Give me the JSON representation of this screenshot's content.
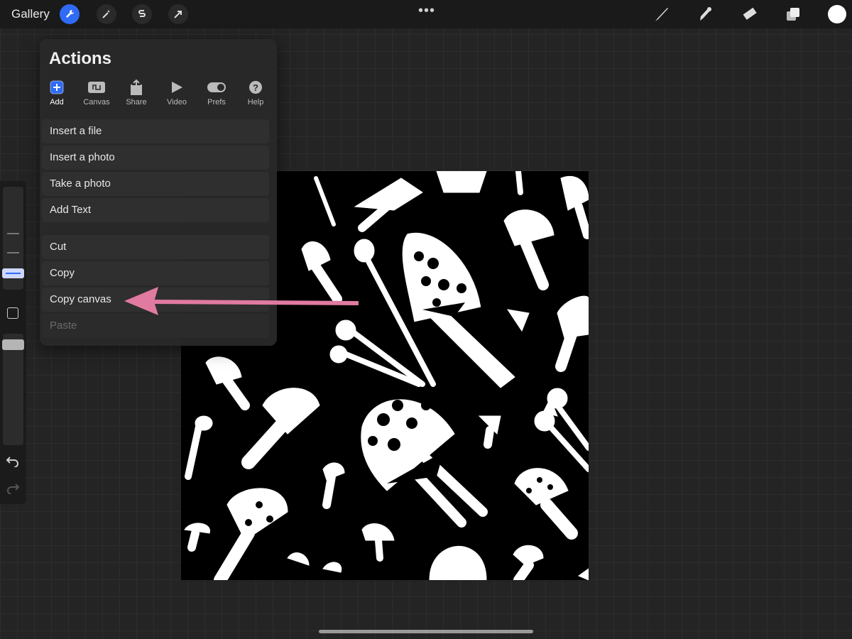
{
  "topbar": {
    "gallery_label": "Gallery",
    "left_tools": [
      "wrench-icon",
      "magic-wand-icon",
      "selection-icon",
      "transform-arrow-icon"
    ],
    "more_dots": "•••",
    "right_tools": [
      "brush-icon",
      "smudge-icon",
      "eraser-icon",
      "layers-icon"
    ],
    "current_color": "#ffffff"
  },
  "actions_panel": {
    "title": "Actions",
    "tabs": [
      {
        "label": "Add",
        "icon": "add-icon",
        "active": true
      },
      {
        "label": "Canvas",
        "icon": "canvas-icon",
        "active": false
      },
      {
        "label": "Share",
        "icon": "share-icon",
        "active": false
      },
      {
        "label": "Video",
        "icon": "video-icon",
        "active": false
      },
      {
        "label": "Prefs",
        "icon": "toggle-icon",
        "active": false
      },
      {
        "label": "Help",
        "icon": "help-icon",
        "active": false
      }
    ],
    "group1": [
      "Insert a file",
      "Insert a photo",
      "Take a photo",
      "Add Text"
    ],
    "group2": [
      {
        "label": "Cut",
        "enabled": true
      },
      {
        "label": "Copy",
        "enabled": true
      },
      {
        "label": "Copy canvas",
        "enabled": true
      },
      {
        "label": "Paste",
        "enabled": false
      }
    ]
  },
  "annotation": {
    "arrow_color": "#e07aa0"
  },
  "accent_color": "#2f6bf5"
}
